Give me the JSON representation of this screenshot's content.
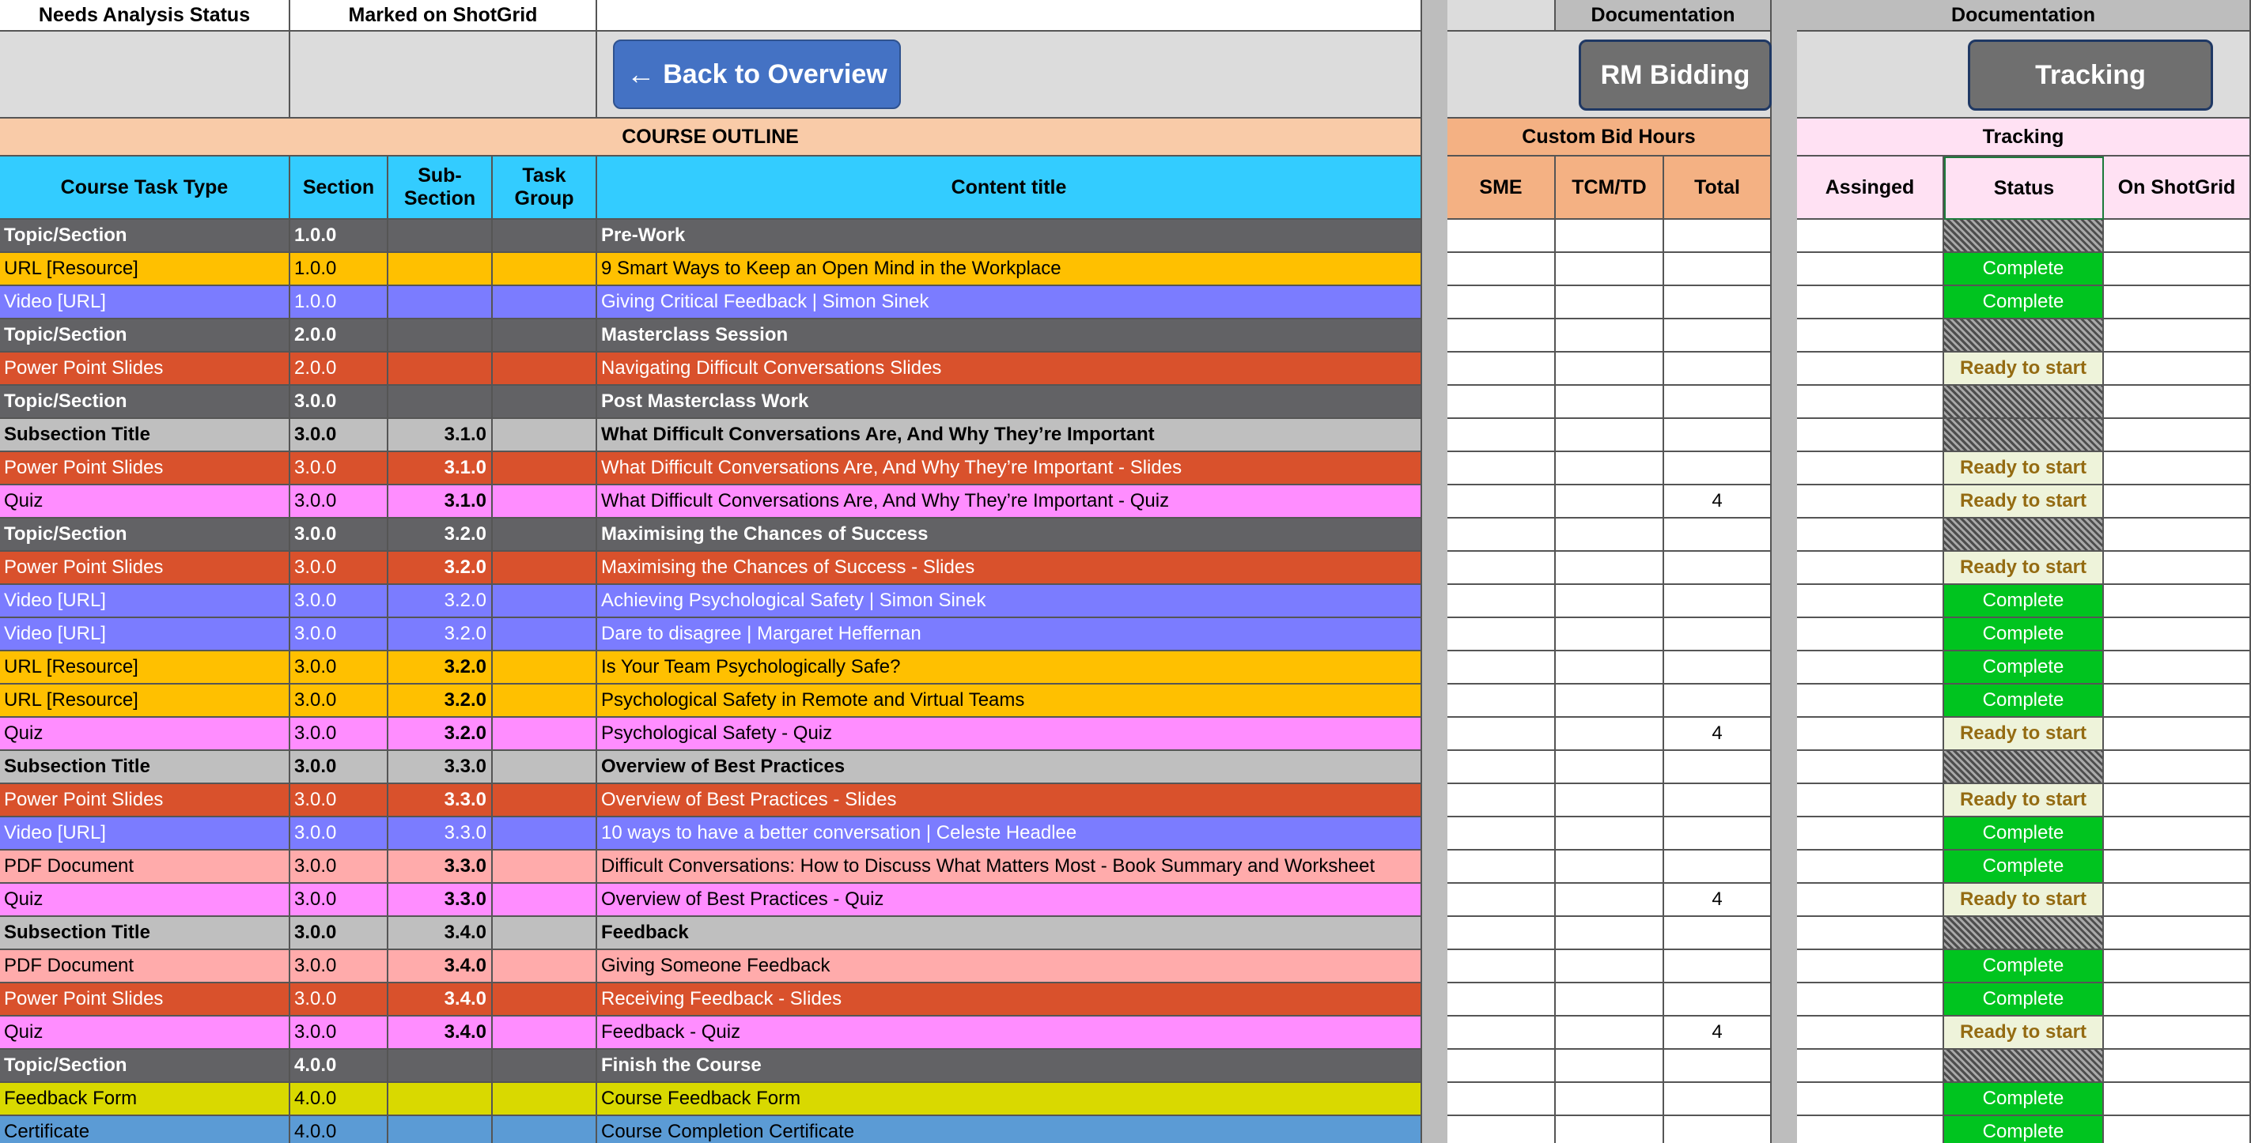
{
  "top_headers": {
    "needs_analysis": "Needs Analysis Status",
    "marked_shotgrid": "Marked on ShotGrid",
    "documentation": "Documentation"
  },
  "buttons": {
    "back": "Back to Overview",
    "rm_bidding": "RM Bidding",
    "tracking": "Tracking"
  },
  "sections": {
    "course_outline": "COURSE OUTLINE",
    "custom_bid_hours": "Custom Bid Hours",
    "tracking": "Tracking"
  },
  "columns": {
    "task_type": "Course Task Type",
    "section": "Section",
    "subsection": "Sub-Section",
    "task_group": "Task Group",
    "content_title": "Content title",
    "sme": "SME",
    "tcm_td": "TCM/TD",
    "total": "Total",
    "assigned": "Assinged",
    "status": "Status",
    "on_shotgrid": "On ShotGrid"
  },
  "colors": {
    "topic": "#626265",
    "url": "#ffc000",
    "video": "#7b7cff",
    "ppt": "#d9512c",
    "subsection": "#bfbfbf",
    "quiz": "#ff8dff",
    "pdf": "#ffabab",
    "form": "#d9d900",
    "cert": "#5b9bd5",
    "header_blue": "#33ccff",
    "outline_peach": "#f9cba8",
    "bid_orange": "#f4b183",
    "tracking_pink": "#ffe1f3",
    "button_blue": "#4472c4",
    "button_gray": "#6f6f6f"
  },
  "rows": [
    {
      "type": "Topic/Section",
      "section": "1.0.0",
      "sub": "",
      "title": "Pre-Work",
      "total": "",
      "status": "",
      "cat": "topic"
    },
    {
      "type": "URL [Resource]",
      "section": "1.0.0",
      "sub": "",
      "title": "9 Smart Ways to Keep an Open Mind in the Workplace",
      "total": "",
      "status": "Complete",
      "cat": "url"
    },
    {
      "type": "Video [URL]",
      "section": "1.0.0",
      "sub": "",
      "title": "Giving Critical Feedback | Simon Sinek",
      "total": "",
      "status": "Complete",
      "cat": "video"
    },
    {
      "type": "Topic/Section",
      "section": "2.0.0",
      "sub": "",
      "title": "Masterclass Session",
      "total": "",
      "status": "",
      "cat": "topic"
    },
    {
      "type": "Power Point Slides",
      "section": "2.0.0",
      "sub": "",
      "title": "Navigating Difficult Conversations Slides",
      "total": "",
      "status": "Ready to start",
      "cat": "ppt"
    },
    {
      "type": "Topic/Section",
      "section": "3.0.0",
      "sub": "",
      "title": "Post Masterclass Work",
      "total": "",
      "status": "",
      "cat": "topic"
    },
    {
      "type": "Subsection Title",
      "section": "3.0.0",
      "sub": "3.1.0",
      "title": "What Difficult Conversations Are, And Why They’re Important",
      "total": "",
      "status": "",
      "cat": "subsection"
    },
    {
      "type": "Power Point Slides",
      "section": "3.0.0",
      "sub": "3.1.0",
      "title": "What Difficult Conversations Are, And Why They’re Important - Slides",
      "total": "",
      "status": "Ready to start",
      "cat": "ppt"
    },
    {
      "type": "Quiz",
      "section": "3.0.0",
      "sub": "3.1.0",
      "title": "What Difficult Conversations Are, And Why They’re Important - Quiz",
      "total": "4",
      "status": "Ready to start",
      "cat": "quiz"
    },
    {
      "type": "Topic/Section",
      "section": "3.0.0",
      "sub": "3.2.0",
      "title": "Maximising the Chances of Success",
      "total": "",
      "status": "",
      "cat": "topic"
    },
    {
      "type": "Power Point Slides",
      "section": "3.0.0",
      "sub": "3.2.0",
      "title": "Maximising the Chances of Success - Slides",
      "total": "",
      "status": "Ready to start",
      "cat": "ppt"
    },
    {
      "type": "Video [URL]",
      "section": "3.0.0",
      "sub": "3.2.0",
      "title": "Achieving Psychological Safety | Simon Sinek",
      "total": "",
      "status": "Complete",
      "cat": "video"
    },
    {
      "type": "Video [URL]",
      "section": "3.0.0",
      "sub": "3.2.0",
      "title": "Dare to disagree | Margaret Heffernan",
      "total": "",
      "status": "Complete",
      "cat": "video"
    },
    {
      "type": "URL [Resource]",
      "section": "3.0.0",
      "sub": "3.2.0",
      "title": "Is Your Team Psychologically Safe?",
      "total": "",
      "status": "Complete",
      "cat": "url"
    },
    {
      "type": "URL [Resource]",
      "section": "3.0.0",
      "sub": "3.2.0",
      "title": "Psychological Safety in Remote and Virtual Teams",
      "total": "",
      "status": "Complete",
      "cat": "url"
    },
    {
      "type": "Quiz",
      "section": "3.0.0",
      "sub": "3.2.0",
      "title": "Psychological Safety - Quiz",
      "total": "4",
      "status": "Ready to start",
      "cat": "quiz"
    },
    {
      "type": "Subsection Title",
      "section": "3.0.0",
      "sub": "3.3.0",
      "title": "Overview of Best Practices",
      "total": "",
      "status": "",
      "cat": "subsection"
    },
    {
      "type": "Power Point Slides",
      "section": "3.0.0",
      "sub": "3.3.0",
      "title": "Overview of Best Practices - Slides",
      "total": "",
      "status": "Ready to start",
      "cat": "ppt"
    },
    {
      "type": "Video [URL]",
      "section": "3.0.0",
      "sub": "3.3.0",
      "title": "10 ways to have a better conversation | Celeste Headlee",
      "total": "",
      "status": "Complete",
      "cat": "video"
    },
    {
      "type": "PDF Document",
      "section": "3.0.0",
      "sub": "3.3.0",
      "title": "Difficult Conversations: How to Discuss What Matters Most - Book Summary and Worksheet",
      "total": "",
      "status": "Complete",
      "cat": "pdf"
    },
    {
      "type": "Quiz",
      "section": "3.0.0",
      "sub": "3.3.0",
      "title": "Overview of Best Practices - Quiz",
      "total": "4",
      "status": "Ready to start",
      "cat": "quiz"
    },
    {
      "type": "Subsection Title",
      "section": "3.0.0",
      "sub": "3.4.0",
      "title": "Feedback",
      "total": "",
      "status": "",
      "cat": "subsection"
    },
    {
      "type": "PDF Document",
      "section": "3.0.0",
      "sub": "3.4.0",
      "title": "Giving Someone Feedback",
      "total": "",
      "status": "Complete",
      "cat": "pdf"
    },
    {
      "type": "Power Point Slides",
      "section": "3.0.0",
      "sub": "3.4.0",
      "title": "Receiving Feedback - Slides",
      "total": "",
      "status": "Complete",
      "cat": "ppt"
    },
    {
      "type": "Quiz",
      "section": "3.0.0",
      "sub": "3.4.0",
      "title": "Feedback - Quiz",
      "total": "4",
      "status": "Ready to start",
      "cat": "quiz"
    },
    {
      "type": "Topic/Section",
      "section": "4.0.0",
      "sub": "",
      "title": "Finish the Course",
      "total": "",
      "status": "",
      "cat": "topic"
    },
    {
      "type": "Feedback Form",
      "section": "4.0.0",
      "sub": "",
      "title": "Course Feedback Form",
      "total": "",
      "status": "Complete",
      "cat": "form"
    },
    {
      "type": "Certificate",
      "section": "4.0.0",
      "sub": "",
      "title": "Course Completion Certificate",
      "total": "",
      "status": "Complete",
      "cat": "cert"
    }
  ]
}
